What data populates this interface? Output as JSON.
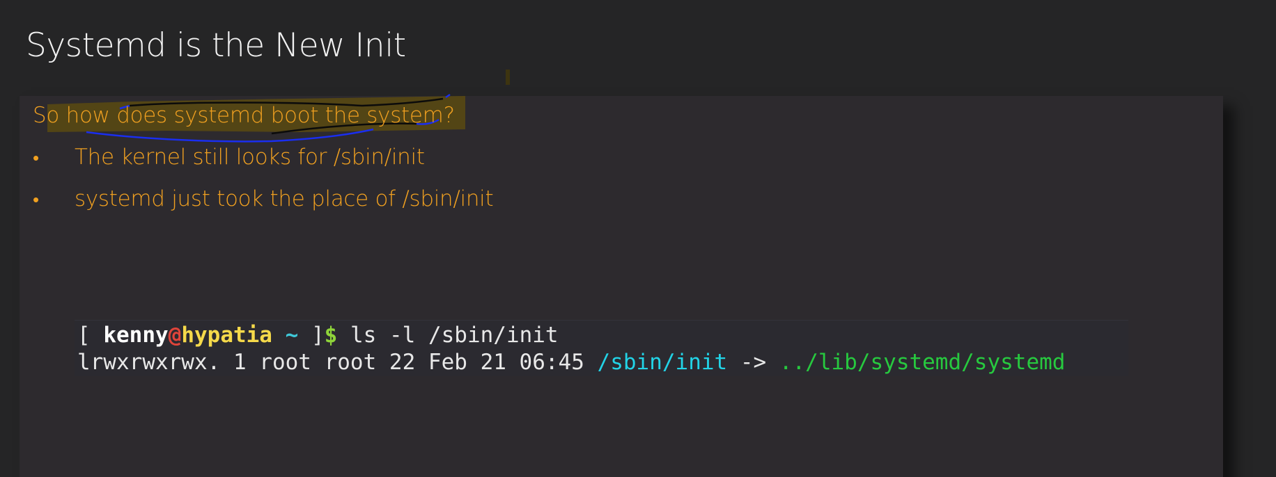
{
  "slide": {
    "title": "Systemd is the New Init",
    "question": "So how does systemd boot the system?",
    "bullet_symbol": "•",
    "bullets": [
      "The kernel still looks for /sbin/init",
      "systemd just took the place of /sbin/init"
    ]
  },
  "terminal": {
    "prompt_open": "[ ",
    "user": "kenny",
    "at": "@",
    "host": "hypatia",
    "path": " ~",
    "prompt_close": " ]",
    "dollar": "$",
    "command": " ls -l /sbin/init",
    "output_prefix": "lrwxrwxrwx. 1 root root 22 Feb 21 06:45 ",
    "link_name": "/sbin/init",
    "arrow": " -> ",
    "link_target": "../lib/systemd/systemd"
  },
  "colors": {
    "background": "#252526",
    "panel": "#2d2a2e",
    "title": "#f2f2f2",
    "accent_orange": "#f0a020",
    "highlighter": "#5a4a10",
    "pen_blue": "#1a2ef0",
    "term_user": "#ffffff",
    "term_at": "#e0443a",
    "term_host": "#f5d94a",
    "term_path": "#3fc8d8",
    "term_dollar": "#8fd43a",
    "term_link": "#22d3e6",
    "term_target": "#27c93f"
  }
}
